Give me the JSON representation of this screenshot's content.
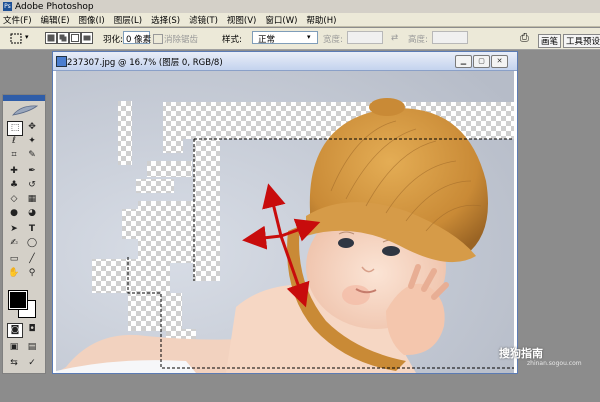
{
  "app": {
    "title": "Adobe Photoshop"
  },
  "menu": [
    "文件(F)",
    "编辑(E)",
    "图像(I)",
    "图层(L)",
    "选择(S)",
    "滤镜(T)",
    "视图(V)",
    "窗口(W)",
    "帮助(H)"
  ],
  "options": {
    "feather_label": "羽化:",
    "feather_value": "0 像素",
    "antialias_label": "消除锯齿",
    "style_label": "样式:",
    "style_value": "正常",
    "width_label": "宽度:",
    "height_label": "高度:",
    "tab_brushes": "画笔",
    "tab_presets": "工具预设"
  },
  "document": {
    "title": "237307.jpg @ 16.7% (图层 0, RGB/8)"
  },
  "watermark": {
    "text": "搜狗指南",
    "url": "zhinan.sogou.com"
  },
  "icons": [
    "photoshop-logo-icon",
    "feather-icon",
    "marquee-tool-icon",
    "move-tool-icon",
    "lasso-tool-icon",
    "magic-wand-tool-icon",
    "crop-tool-icon",
    "slice-tool-icon",
    "healing-brush-icon",
    "brush-tool-icon",
    "stamp-tool-icon",
    "history-brush-icon",
    "eraser-tool-icon",
    "gradient-tool-icon",
    "blur-tool-icon",
    "dodge-tool-icon",
    "path-select-icon",
    "type-tool-icon",
    "pen-tool-icon",
    "shape-tool-icon",
    "notes-tool-icon",
    "eyedropper-tool-icon",
    "hand-tool-icon",
    "zoom-tool-icon",
    "quickmask-icon",
    "screen-mode-icon",
    "arrow-annotation-icon"
  ]
}
